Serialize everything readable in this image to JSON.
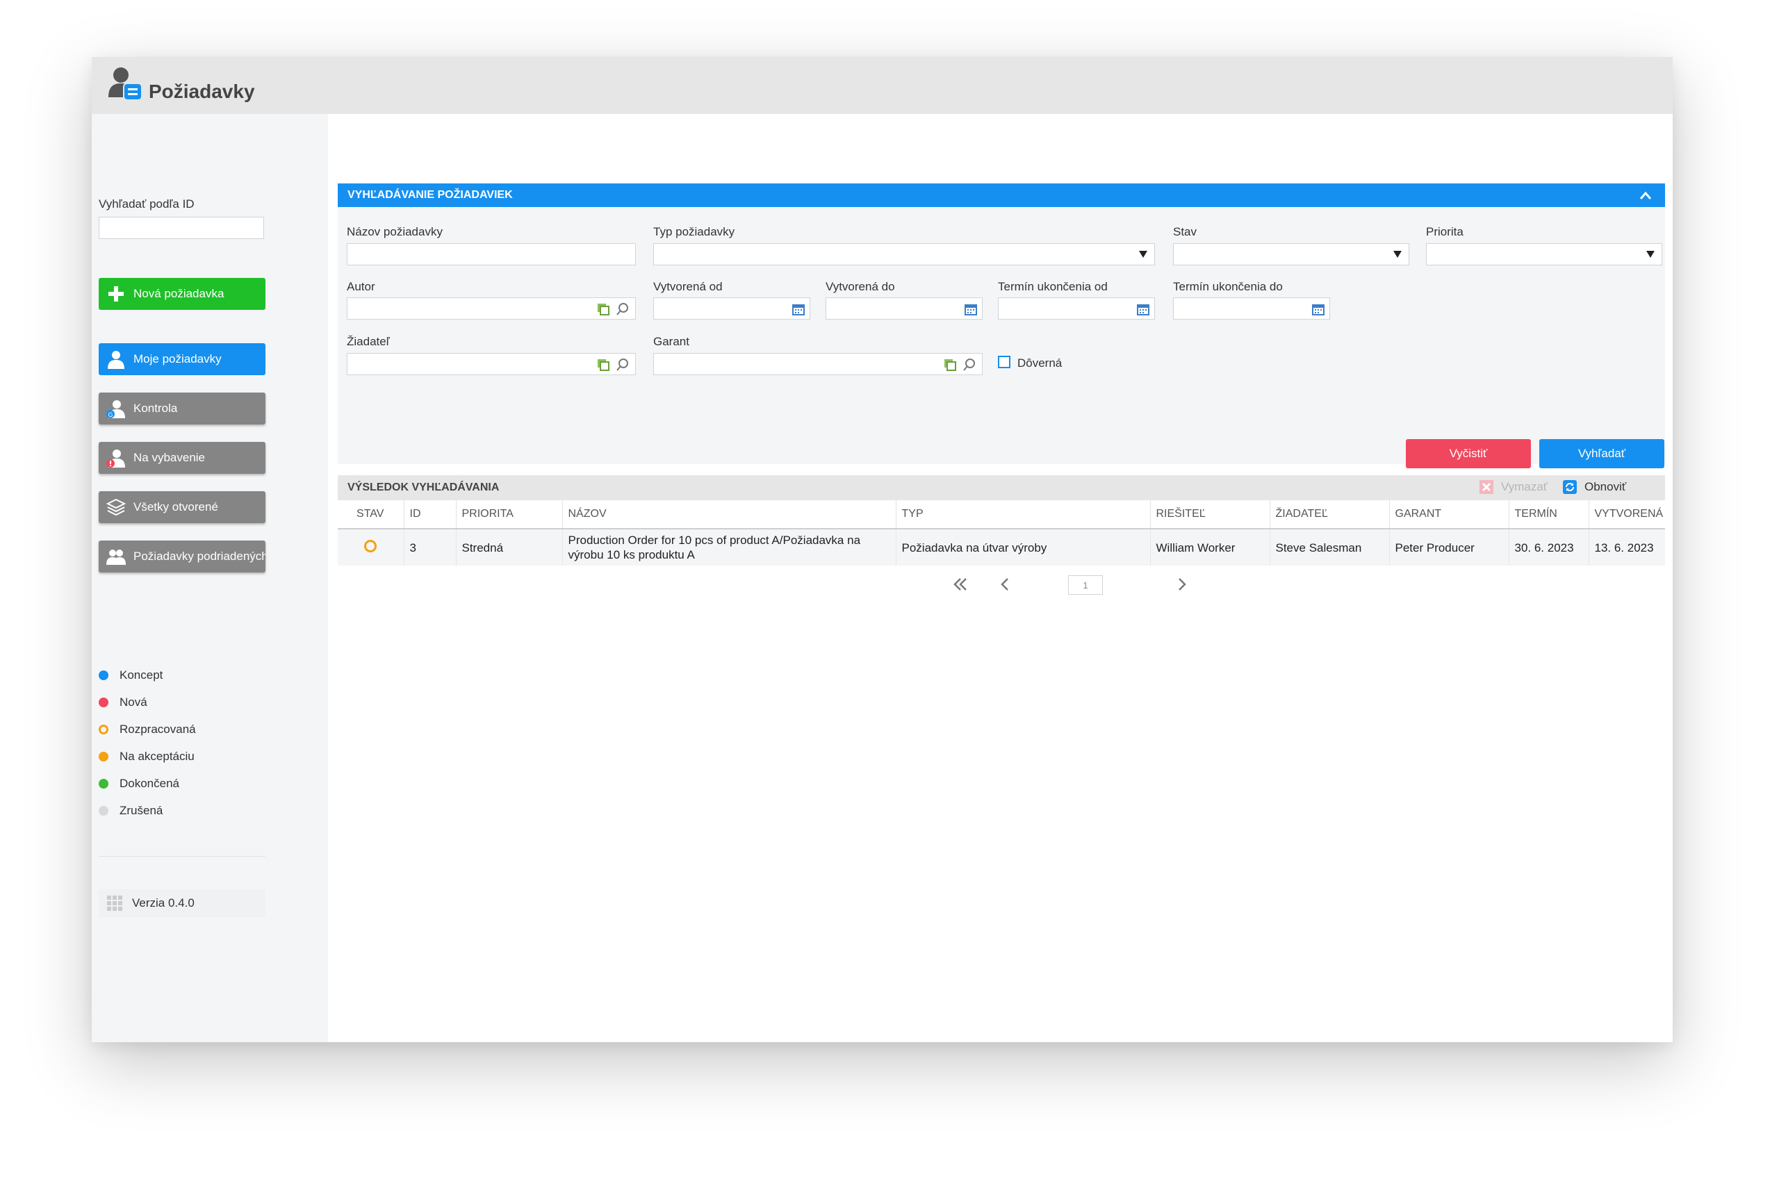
{
  "app": {
    "title": "Požiadavky"
  },
  "sidebar": {
    "search_label": "Vyhľadať podľa ID",
    "search_value": "",
    "buttons": [
      {
        "label": "Nová požiadavka",
        "icon": "plus-icon"
      },
      {
        "label": "Moje požiadavky",
        "icon": "user-icon"
      },
      {
        "label": "Kontrola",
        "icon": "user-check-icon"
      },
      {
        "label": "Na vybavenie",
        "icon": "user-alert-icon"
      },
      {
        "label": "Všetky otvorené",
        "icon": "layers-icon"
      },
      {
        "label": "Požiadavky podriadených",
        "icon": "users-icon"
      }
    ],
    "legend": [
      {
        "label": "Koncept",
        "color": "#1590f0",
        "style": "filled"
      },
      {
        "label": "Nová",
        "color": "#f0475e",
        "style": "filled"
      },
      {
        "label": "Rozpracovaná",
        "color": "#f5a10f",
        "style": "ring"
      },
      {
        "label": "Na akceptáciu",
        "color": "#f5a10f",
        "style": "filled"
      },
      {
        "label": "Dokončená",
        "color": "#3dba36",
        "style": "filled"
      },
      {
        "label": "Zrušená",
        "color": "#d9d9d9",
        "style": "filled"
      }
    ],
    "version": "Verzia 0.4.0"
  },
  "search_panel": {
    "title": "Vyhľadávanie požiadaviek",
    "fields": {
      "nazov": "Názov požiadavky",
      "typ": "Typ požiadavky",
      "stav": "Stav",
      "priorita": "Priorita",
      "autor": "Autor",
      "vytvorena_od": "Vytvorená od",
      "vytvorena_do": "Vytvorená do",
      "termin_od": "Termín ukončenia od",
      "termin_do": "Termín ukončenia do",
      "ziadatel": "Žiadateľ",
      "garant": "Garant",
      "doverna": "Dôverná"
    },
    "clear_label": "Vyčistiť",
    "search_label": "Vyhľadať"
  },
  "results": {
    "title": "Výsledok vyhľadávania",
    "delete_label": "Vymazať",
    "refresh_label": "Obnoviť",
    "columns": [
      "Stav",
      "ID",
      "Priorita",
      "Názov",
      "Typ",
      "Riešiteľ",
      "Žiadateľ",
      "Garant",
      "Termín",
      "Vytvorená"
    ],
    "rows": [
      {
        "stav": "Rozpracovaná",
        "id": "3",
        "priorita": "Stredná",
        "nazov": "Production Order for 10 pcs of product A/Požiadavka na výrobu 10 ks produktu A",
        "typ": "Požiadavka na útvar výroby",
        "riesitel": "William Worker",
        "ziadatel": "Steve Salesman",
        "garant": "Peter Producer",
        "termin": "30. 6. 2023",
        "vytvorena": "13. 6. 2023"
      }
    ],
    "page": "1"
  },
  "colors": {
    "primary": "#1590f0",
    "success": "#1fbf29",
    "danger": "#f0475e",
    "neutral_button": "#858585"
  }
}
